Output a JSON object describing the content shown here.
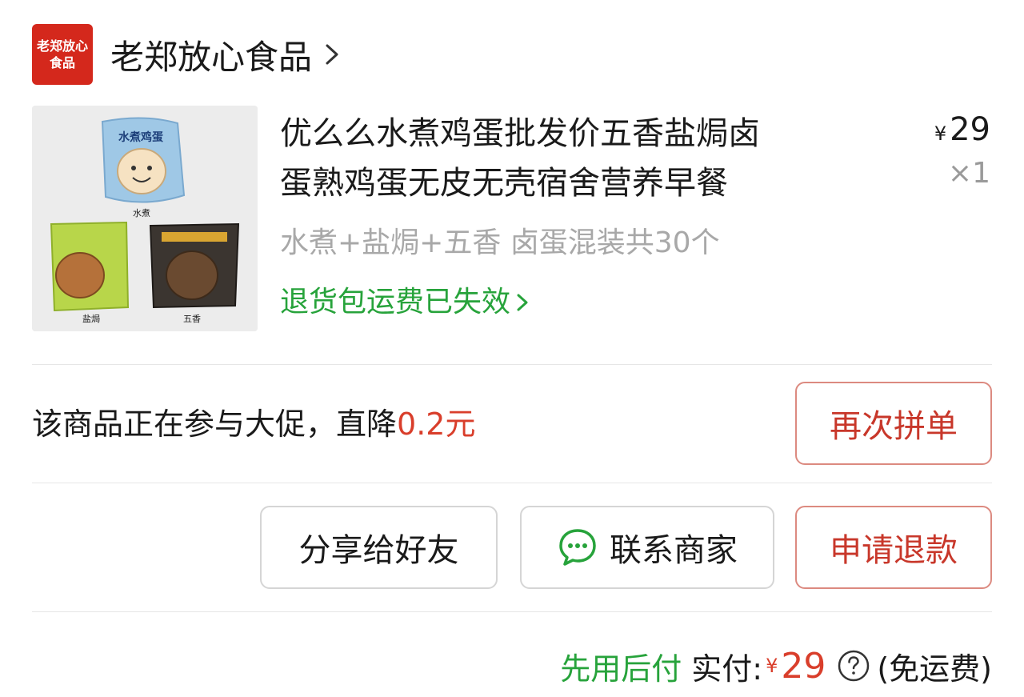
{
  "store": {
    "logo_line1": "老郑放心",
    "logo_line2": "食品",
    "name": "老郑放心食品",
    "chevron_icon": "chevron-right-icon"
  },
  "product": {
    "title_line1": "优么么水煮鸡蛋批发价五香盐焗卤",
    "title_line2": "蛋熟鸡蛋无皮无壳宿舍营养早餐",
    "currency": "¥",
    "price": "29",
    "quantity": "×1",
    "spec": "水煮+盐焗+五香 卤蛋混装共30个",
    "return_note": "退货包运费已失效",
    "image_labels": {
      "top_pack": "水煮鸡蛋",
      "top": "水煮",
      "left": "盐焗",
      "right": "五香"
    }
  },
  "promo": {
    "text": "该商品正在参与大促，直降",
    "amount": "0.2元"
  },
  "buttons": {
    "reorder": "再次拼单",
    "share": "分享给好友",
    "contact": "联系商家",
    "refund": "申请退款"
  },
  "footer": {
    "pay_later": "先用后付",
    "paid_label": "实付:",
    "currency": "¥",
    "total": "29",
    "freight": "(免运费)"
  },
  "colors": {
    "accent_red": "#d93e2b",
    "green": "#27a33b",
    "logo_red": "#d4281c"
  }
}
